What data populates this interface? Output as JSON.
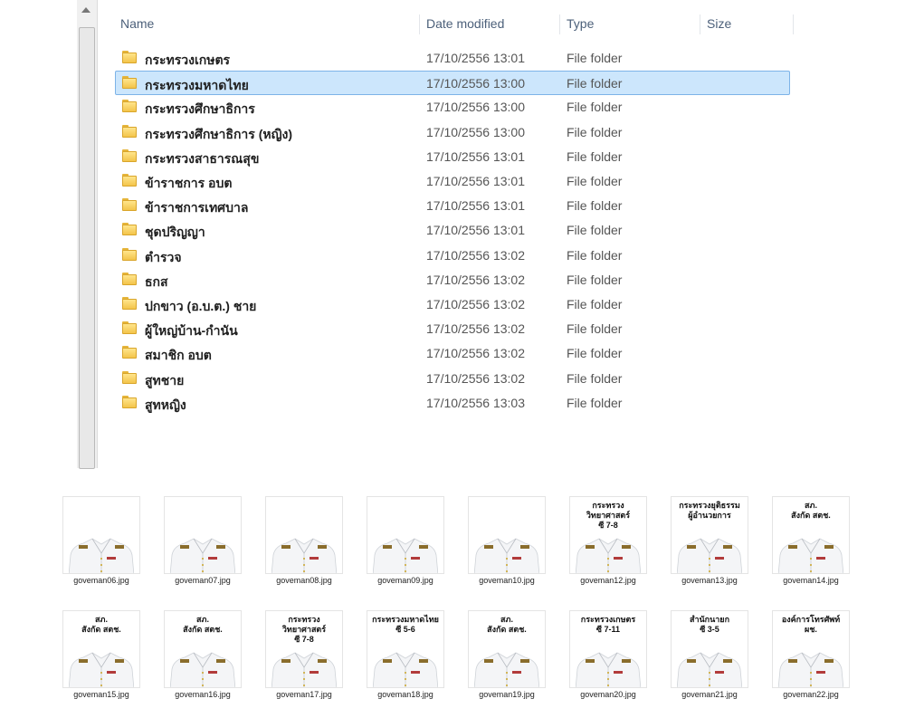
{
  "columns": {
    "name": "Name",
    "date": "Date modified",
    "type": "Type",
    "size": "Size"
  },
  "files": [
    {
      "name": "กระทรวงเกษตร",
      "date": "17/10/2556 13:01",
      "type": "File folder"
    },
    {
      "name": "กระทรวงมหาดไทย",
      "date": "17/10/2556 13:00",
      "type": "File folder",
      "selected": true
    },
    {
      "name": "กระทรวงศึกษาธิการ",
      "date": "17/10/2556 13:00",
      "type": "File folder"
    },
    {
      "name": "กระทรวงศึกษาธิการ (หญิง)",
      "date": "17/10/2556 13:00",
      "type": "File folder"
    },
    {
      "name": "กระทรวงสาธารณสุข",
      "date": "17/10/2556 13:01",
      "type": "File folder"
    },
    {
      "name": "ข้าราชการ อบต",
      "date": "17/10/2556 13:01",
      "type": "File folder"
    },
    {
      "name": "ข้าราชการเทศบาล",
      "date": "17/10/2556 13:01",
      "type": "File folder"
    },
    {
      "name": "ชุดปริญญา",
      "date": "17/10/2556 13:01",
      "type": "File folder"
    },
    {
      "name": "ตำรวจ",
      "date": "17/10/2556 13:02",
      "type": "File folder"
    },
    {
      "name": "ธกส",
      "date": "17/10/2556 13:02",
      "type": "File folder"
    },
    {
      "name": "ปกขาว (อ.บ.ต.) ชาย",
      "date": "17/10/2556 13:02",
      "type": "File folder"
    },
    {
      "name": "ผู้ใหญ่บ้าน-กำนัน",
      "date": "17/10/2556 13:02",
      "type": "File folder"
    },
    {
      "name": "สมาชิก อบต",
      "date": "17/10/2556 13:02",
      "type": "File folder"
    },
    {
      "name": "สูทชาย",
      "date": "17/10/2556 13:02",
      "type": "File folder"
    },
    {
      "name": "สูทหญิง",
      "date": "17/10/2556 13:03",
      "type": "File folder"
    }
  ],
  "thumbnails": [
    {
      "file": "goveman06.jpg",
      "caption": ""
    },
    {
      "file": "goveman07.jpg",
      "caption": ""
    },
    {
      "file": "goveman08.jpg",
      "caption": ""
    },
    {
      "file": "goveman09.jpg",
      "caption": ""
    },
    {
      "file": "goveman10.jpg",
      "caption": ""
    },
    {
      "file": "goveman12.jpg",
      "caption": "กระทรวงวิทยาศาสตร์\nซี 7-8"
    },
    {
      "file": "goveman13.jpg",
      "caption": "กระทรวงยุติธรรม\nผู้อำนวยการ"
    },
    {
      "file": "goveman14.jpg",
      "caption": "สภ.\nสังกัด สตช."
    },
    {
      "file": "goveman15.jpg",
      "caption": "สภ.\nสังกัด สตช."
    },
    {
      "file": "goveman16.jpg",
      "caption": "สภ.\nสังกัด สตช."
    },
    {
      "file": "goveman17.jpg",
      "caption": "กระทรวงวิทยาศาสตร์\nซี 7-8"
    },
    {
      "file": "goveman18.jpg",
      "caption": "กระทรวงมหาดไทย\nซี 5-6"
    },
    {
      "file": "goveman19.jpg",
      "caption": "สภ.\nสังกัด สตช."
    },
    {
      "file": "goveman20.jpg",
      "caption": "กระทรวงเกษตร\nซี 7-11"
    },
    {
      "file": "goveman21.jpg",
      "caption": "สำนักนายก\nซี 3-5"
    },
    {
      "file": "goveman22.jpg",
      "caption": "องค์การโทรศัพท์\nผช."
    }
  ],
  "colors": {
    "selection": "#cce6fc",
    "selection_border": "#7db3e8",
    "header_text": "#4c607a"
  }
}
